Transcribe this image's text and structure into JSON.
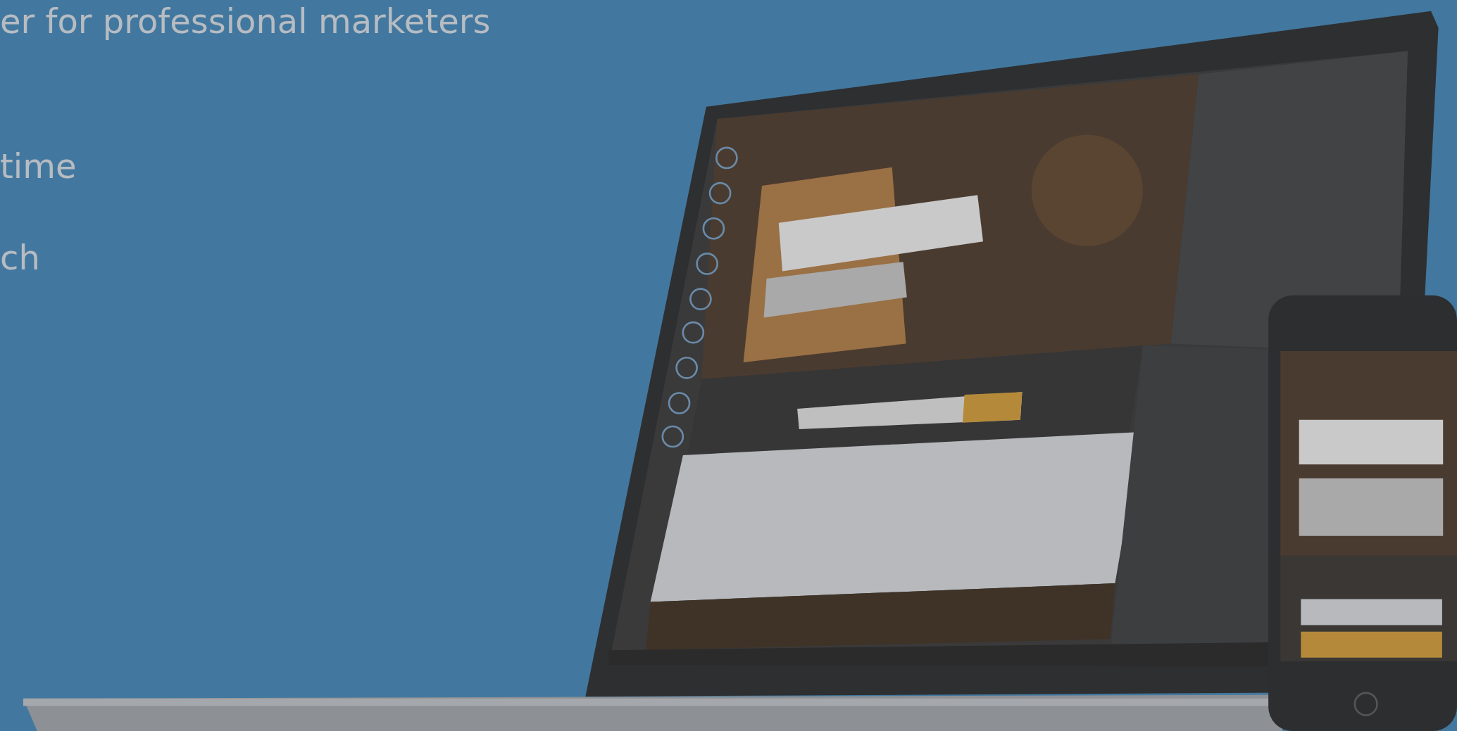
{
  "hero": {
    "headline": "er for professional marketers",
    "features": [
      "time",
      "ch"
    ]
  }
}
